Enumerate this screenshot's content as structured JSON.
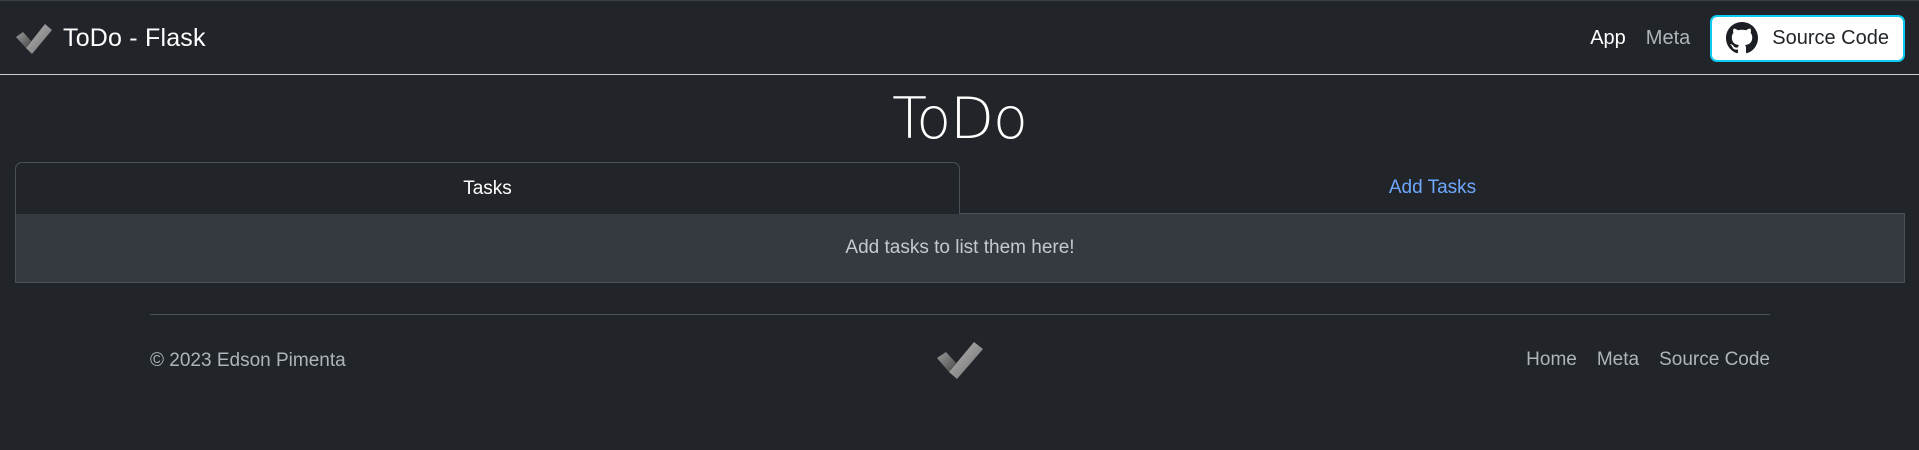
{
  "navbar": {
    "brand": {
      "logo_icon": "checkmark-logo-icon",
      "title": "ToDo - Flask"
    },
    "links": [
      {
        "label": "App",
        "active": true
      },
      {
        "label": "Meta",
        "active": false
      }
    ],
    "source_button": {
      "icon": "github-icon",
      "label": "Source Code"
    }
  },
  "main": {
    "title": "ToDo",
    "tabs": [
      {
        "label": "Tasks",
        "active": true
      },
      {
        "label": "Add Tasks",
        "active": false
      }
    ],
    "tasks_panel": {
      "empty_message": "Add tasks to list them here!"
    }
  },
  "footer": {
    "copyright": "© 2023 Edson Pimenta",
    "logo_icon": "checkmark-logo-icon",
    "links": [
      {
        "label": "Home"
      },
      {
        "label": "Meta"
      },
      {
        "label": "Source Code"
      }
    ]
  },
  "colors": {
    "background": "#212529",
    "panel": "#343a40",
    "accent_link": "#6ea8fe",
    "source_button_border": "#0dcaf0",
    "muted_text": "#aeb4ba"
  }
}
